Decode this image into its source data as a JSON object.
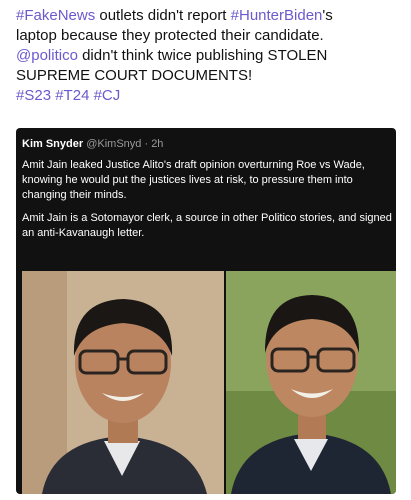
{
  "post": {
    "line1": {
      "tag1": "#FakeNews",
      "text1": " outlets didn't report ",
      "tag2": "#HunterBiden",
      "text2": "'s"
    },
    "line2": "laptop because they protected their candidate.",
    "line3": {
      "mention": "@politico",
      "text": " didn't think twice publishing STOLEN"
    },
    "line4": "SUPREME COURT DOCUMENTS!",
    "hashtags": [
      "#S23",
      "#T24",
      "#CJ"
    ]
  },
  "embed": {
    "author": "Kim Snyder",
    "handle": "@KimSnyd",
    "dot": "·",
    "time": "2h",
    "paragraph1": "Amit Jain leaked Justice Alito's draft opinion overturning Roe vs Wade, knowing he would put the justices lives at risk, to pressure them into changing their minds.",
    "paragraph2": "Amit Jain is a Sotomayor clerk, a source in other Politico stories, and signed an anti-Kavanaugh letter."
  },
  "colors": {
    "hashtag": "#6a5acd",
    "embed_bg": "#111111"
  }
}
